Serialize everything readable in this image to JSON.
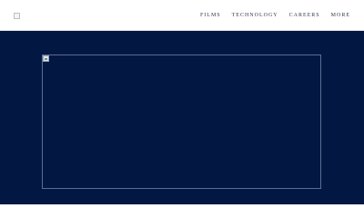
{
  "header": {
    "logo_icon": "broken-image-icon",
    "nav": [
      {
        "label": "FILMS"
      },
      {
        "label": "TECHNOLOGY"
      },
      {
        "label": "CAREERS"
      },
      {
        "label": "MORE"
      }
    ]
  },
  "hero": {
    "background_color": "#021742",
    "frame_border_color": "#5d6d94",
    "image_icon": "broken-image-icon"
  }
}
